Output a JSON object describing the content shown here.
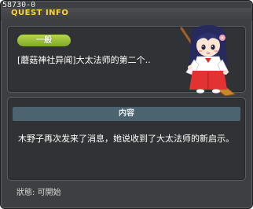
{
  "quest": {
    "id": "58730-0",
    "window_title": "QUEST INFO",
    "category_badge": "一般",
    "name": "[蘑菇神社异闻]大太法师的第二个..",
    "section_header": "内容",
    "description": "木野子再次发来了消息，她说收到了大太法师的新启示。",
    "status": "狀態:  可開始"
  },
  "icons": {
    "npc_portrait": "shrine-maiden-with-broom-npc"
  },
  "colors": {
    "title": "#ffd631",
    "badge": "#9cc23a",
    "section_header": "#4c6470",
    "window_bg": "#3e3f42",
    "panel_bg": "#313236"
  }
}
